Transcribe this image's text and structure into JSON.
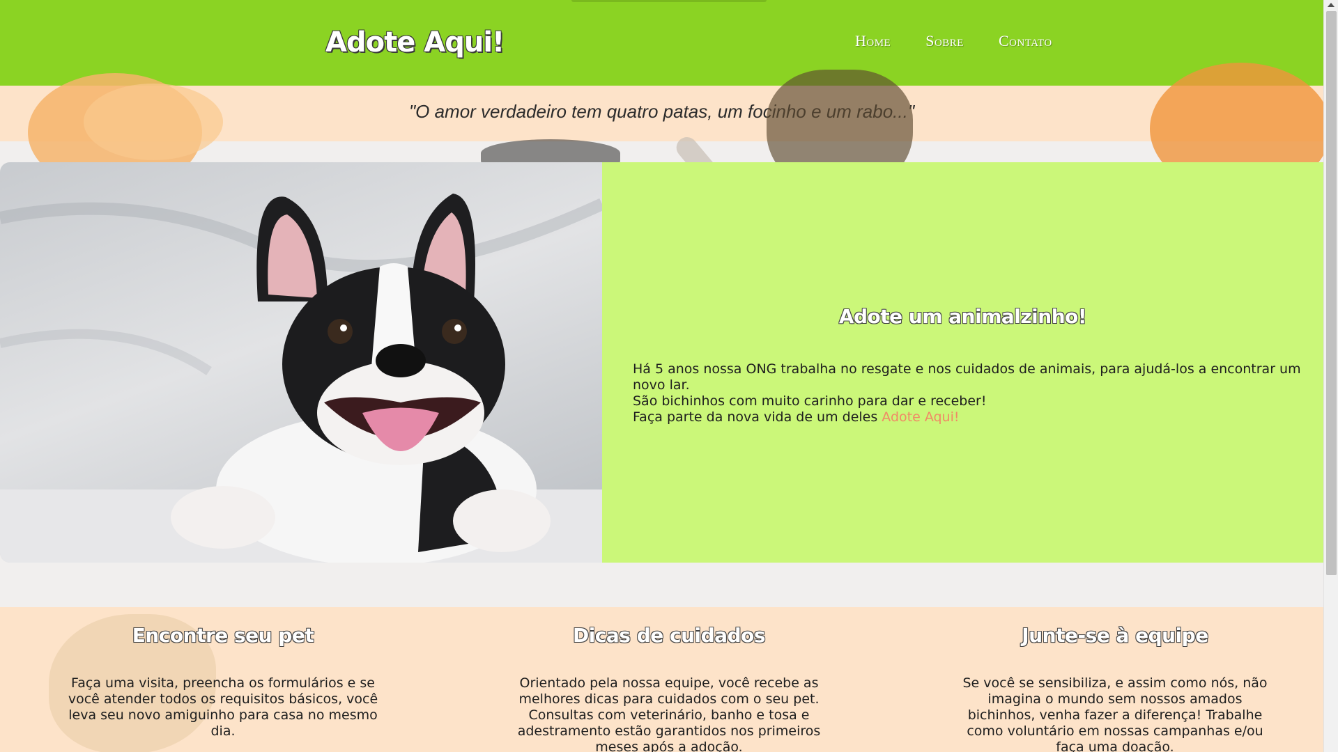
{
  "header": {
    "logo": "Adote Aqui!",
    "nav": [
      "Home",
      "Sobre",
      "Contato"
    ]
  },
  "quote": "\"O amor verdadeiro tem quatro patas, um focinho e um rabo...\"",
  "hero": {
    "image_icon": "french-bulldog-photo",
    "title": "Adote um animalzinho!",
    "lines": [
      "Há 5 anos nossa ONG trabalha no resgate e nos cuidados de animais, para ajudá-los a encontrar um novo lar.",
      "São bichinhos com muito carinho para dar e receber!"
    ],
    "last_line_prefix": "Faça parte da nova vida de um deles ",
    "link_text": "Adote Aqui!"
  },
  "sections": [
    {
      "title": "Encontre seu pet",
      "text": "Faça uma visita, preencha os formulários e se você atender todos os requisitos básicos, você leva seu novo amiguinho para casa no mesmo dia."
    },
    {
      "title": "Dicas de cuidados",
      "text": "Orientado pela nossa equipe, você recebe as melhores dicas para cuidados com o seu pet. Consultas com veterinário, banho e tosa e adestramento estão garantidos nos primeiros meses após a adoção."
    },
    {
      "title": "Junte-se à equipe",
      "text": "Se você se sensibiliza, e assim como nós, não imagina o mundo sem nossos amados bichinhos, venha fazer a diferença! Trabalhe como voluntário em nossas campanhas e/ou faça uma doação."
    }
  ],
  "colors": {
    "header": "#8bd323",
    "quote_band": "#fde3c9",
    "hero_panel": "#cbf779",
    "link": "#f08a66"
  }
}
